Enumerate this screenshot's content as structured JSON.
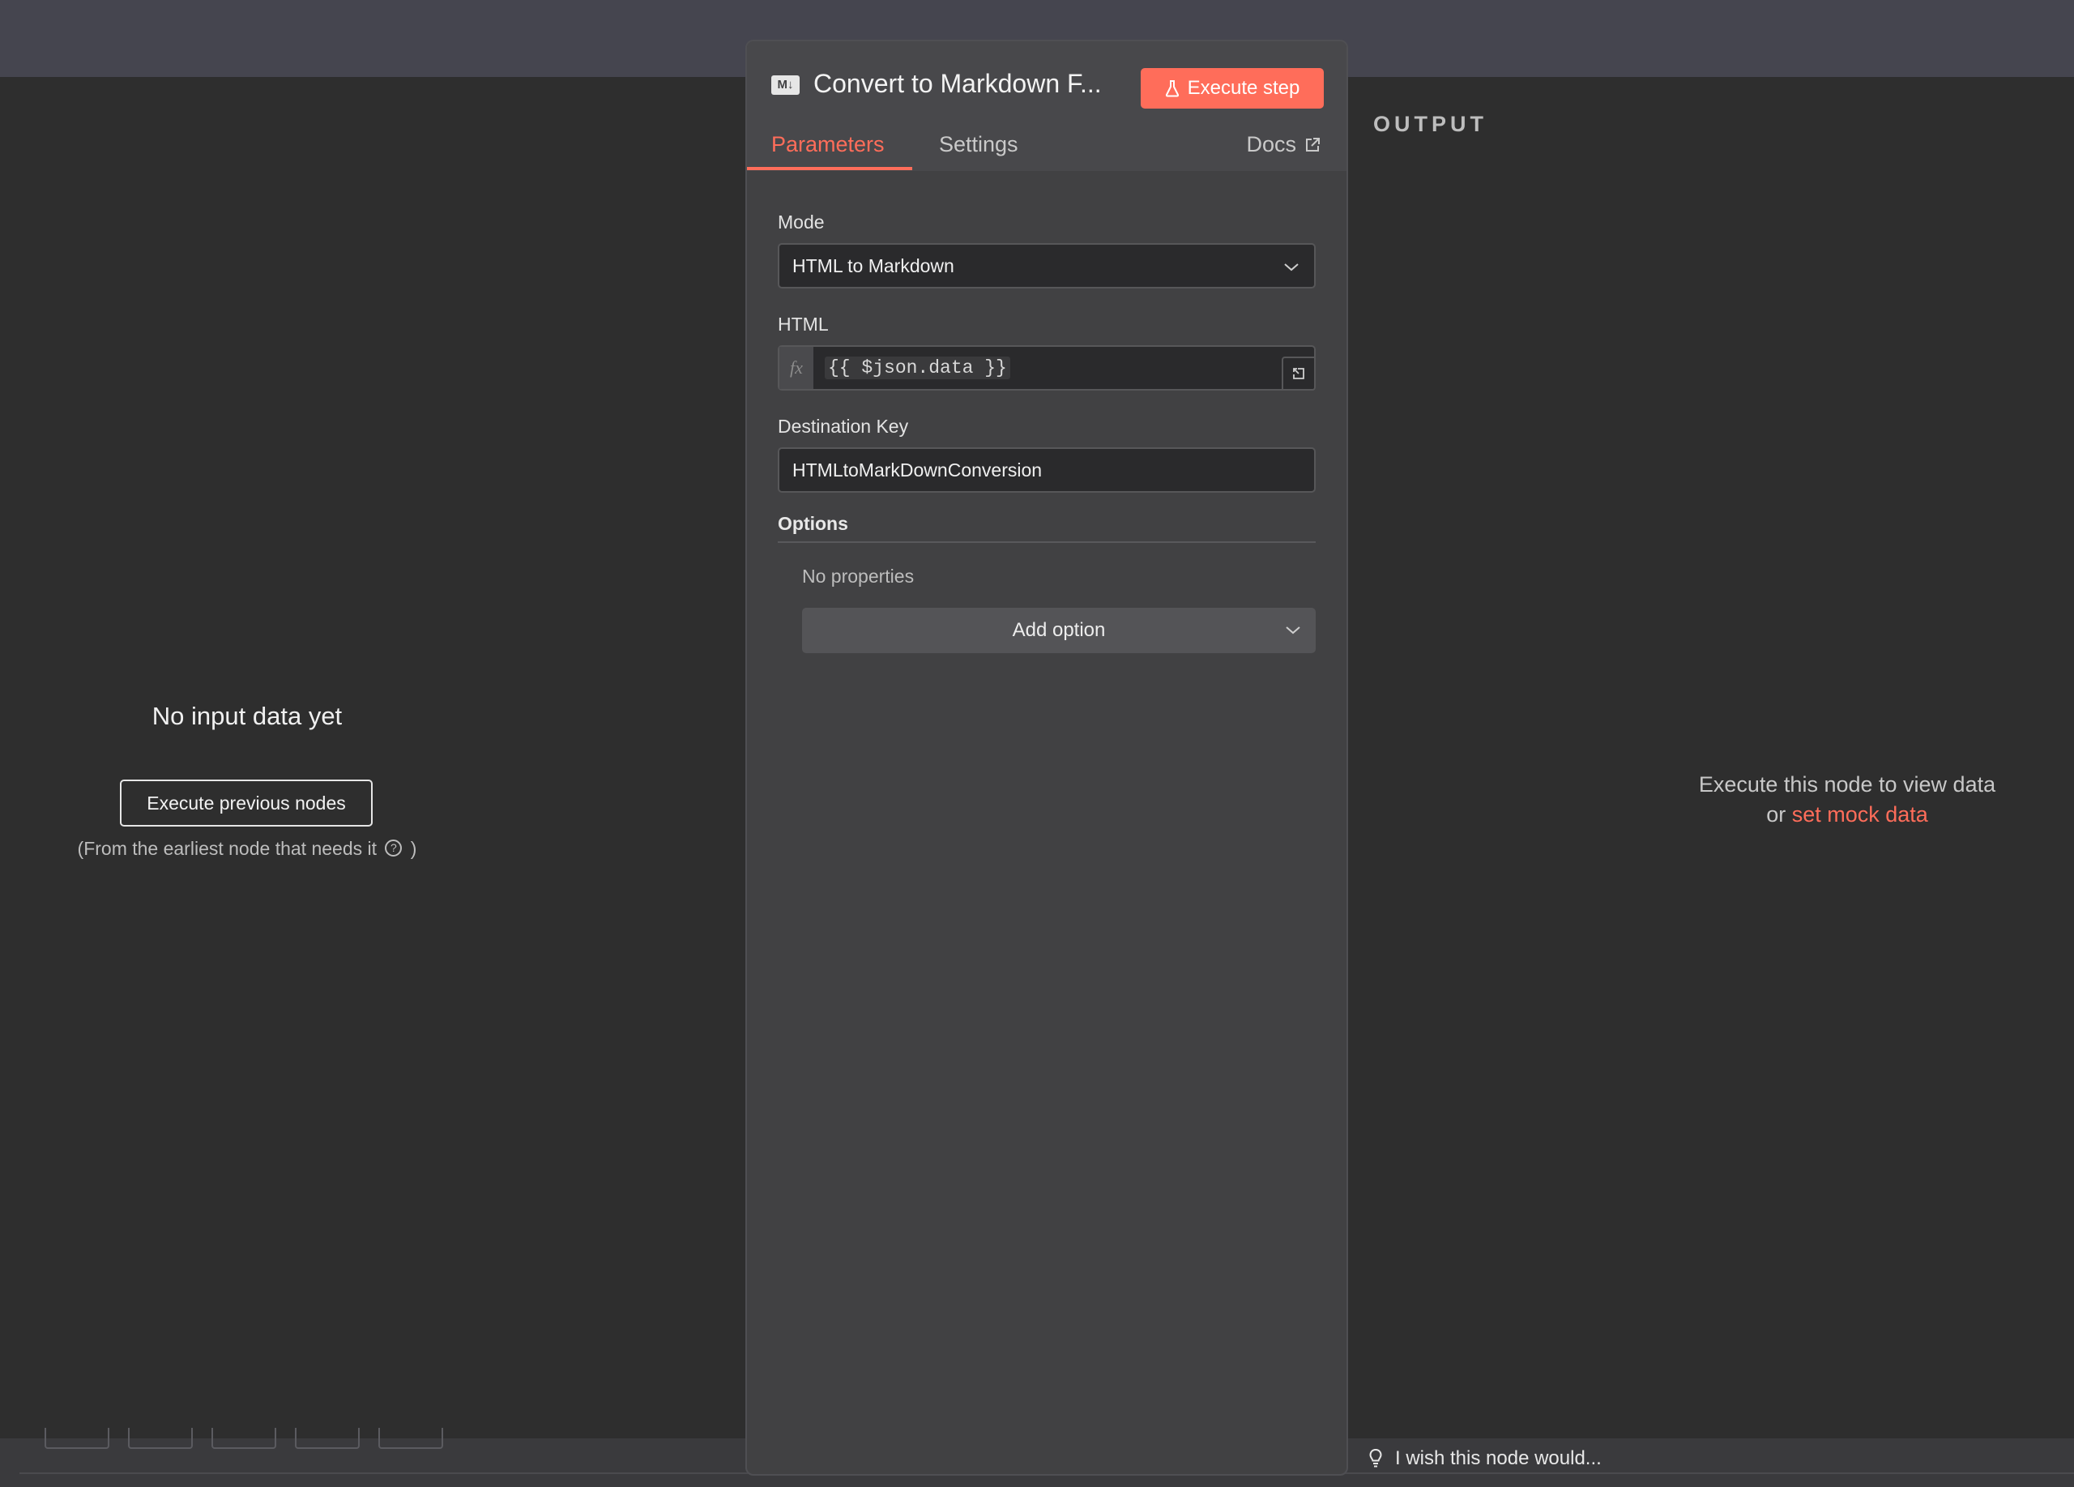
{
  "panel": {
    "node_icon_label": "M↓",
    "title": "Convert to Markdown F...",
    "execute_step_label": "Execute step",
    "tabs": [
      {
        "label": "Parameters"
      },
      {
        "label": "Settings"
      }
    ],
    "docs_label": "Docs",
    "fields": {
      "mode": {
        "label": "Mode",
        "value": "HTML to Markdown"
      },
      "html": {
        "label": "HTML",
        "fx": "fx",
        "value": "{{ $json.data }}"
      },
      "destination_key": {
        "label": "Destination Key",
        "value": "HTMLtoMarkDownConversion"
      }
    },
    "options": {
      "title": "Options",
      "empty_text": "No properties",
      "add_label": "Add option"
    }
  },
  "input": {
    "title": "No input data yet",
    "execute_previous_label": "Execute previous nodes",
    "note_before": "(From the earliest node that needs it",
    "note_help": "?",
    "note_after": ")"
  },
  "output": {
    "label": "OUTPUT",
    "message_line1": "Execute this node to view data",
    "message_or": "or",
    "mock_link": "set mock data"
  },
  "feedback": {
    "text": "I wish this node would..."
  },
  "colors": {
    "accent": "#ff6d5a",
    "background": "#2e2e2e",
    "panel": "#414143"
  }
}
